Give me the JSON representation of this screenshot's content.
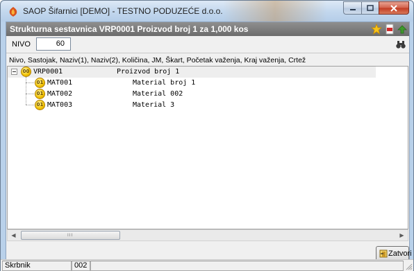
{
  "window": {
    "title": "SAOP Šifarnici [DEMO] - TESTNO PODUZEĆE d.o.o.",
    "controls": {
      "minimize_icon": "minimize-icon",
      "maximize_icon": "maximize-icon",
      "close_icon": "close-icon"
    }
  },
  "header": {
    "title": "Strukturna sestavnica VRP0001 Proizvod broj 1  za 1,000 kos",
    "icons": [
      "star-icon",
      "pdf-icon",
      "export-icon"
    ]
  },
  "filter": {
    "label": "NIVO",
    "value": "60",
    "search_icon": "binoculars-icon"
  },
  "columns_header": "Nivo, Sastojak, Naziv(1), Naziv(2), Količina, JM, Škart, Početak važenja, Kraj važenja, Crtež",
  "tree": {
    "root": {
      "level": "00",
      "code": "VRP0001",
      "name": "Proizvod broj 1",
      "expanded": true
    },
    "children": [
      {
        "level": "01",
        "code": "MAT001",
        "name": "Material broj 1"
      },
      {
        "level": "01",
        "code": "MAT002",
        "name": "Material 002"
      },
      {
        "level": "01",
        "code": "MAT003",
        "name": "Material 3"
      }
    ]
  },
  "scrollbar": {
    "grip": "III"
  },
  "buttons": {
    "close_label": "Zatvori"
  },
  "status": {
    "field1": "Skrbnik",
    "field2": "002",
    "field3": ""
  },
  "colors": {
    "header_bg": "#7a7a7a",
    "titlebar": "#c4d8ee",
    "node_icon": "#f2c200"
  }
}
